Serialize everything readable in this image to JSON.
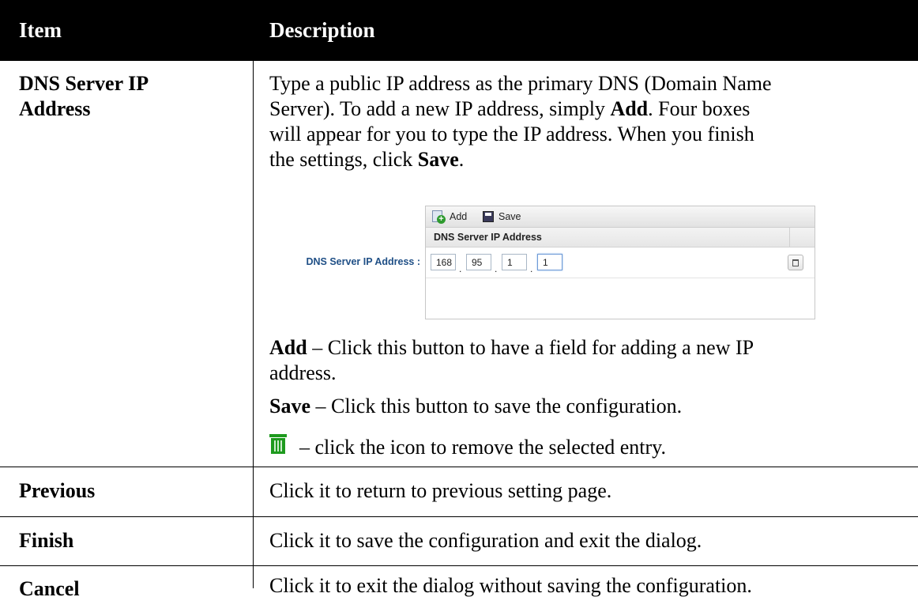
{
  "header": {
    "item": "Item",
    "description": "Description"
  },
  "rows": {
    "dns": {
      "item": [
        "DNS Server IP",
        "Address"
      ],
      "intro": {
        "p1": "Type a public IP address as the primary DNS (Domain Name",
        "p2a": "Server). To add a new IP address, simply ",
        "p2b": "Add",
        "p2c": ". Four boxes",
        "p3": "will appear for you to type the IP address. When you finish",
        "p4a": "the settings, click ",
        "p4b": "Save",
        "p4c": "."
      },
      "screenshot": {
        "label": "DNS Server IP Address :",
        "toolbar": {
          "add": "Add",
          "save": "Save"
        },
        "column_header": "DNS Server IP Address",
        "ip": [
          "168",
          "95",
          "1",
          "1"
        ],
        "dot": "."
      },
      "add_note": {
        "term": "Add",
        "line1": " – Click this button to have a field for adding a new IP",
        "line2": "address."
      },
      "save_note": {
        "term": "Save",
        "text": " – Click this button to save the configuration."
      },
      "trash_note": {
        "text": "– click the icon to remove the selected entry."
      }
    },
    "previous": {
      "item": "Previous",
      "desc": "Click it to return to previous setting page."
    },
    "finish": {
      "item": "Finish",
      "desc": "Click it to save the configuration and exit the dialog."
    },
    "cancel": {
      "item": "Cancel",
      "desc": "Click it to exit the dialog without saving the configuration."
    }
  }
}
